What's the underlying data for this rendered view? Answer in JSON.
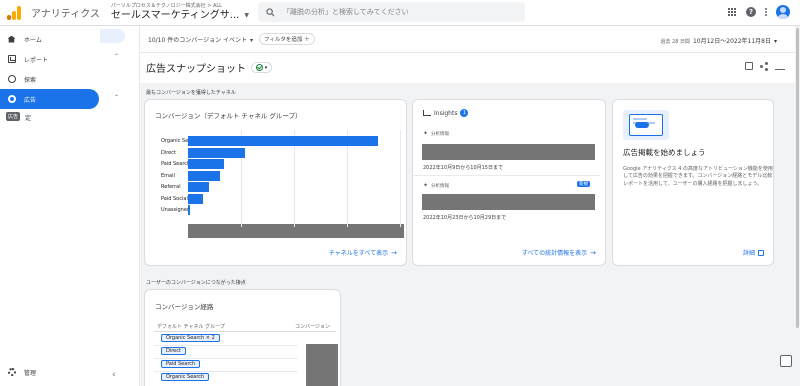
{
  "app": {
    "name": "アナリティクス",
    "account_crumb": "パーソルプロセス＆テクノロジー株式会社 > ALL",
    "property": "セールスマーケティングサ..."
  },
  "search": {
    "placeholder": "「離脱の分析」と検索してみてください"
  },
  "nav": {
    "items": [
      {
        "label": "ホーム",
        "icon": "home-icon"
      },
      {
        "label": "レポート",
        "icon": "reports-icon"
      },
      {
        "label": "探索",
        "icon": "explore-icon"
      },
      {
        "label": "広告",
        "icon": "advertising-icon",
        "active": true
      }
    ],
    "tooltip": "広告",
    "tooltip_rest": "定",
    "admin": "管理"
  },
  "filterbar": {
    "events": "10/10 件のコンバージョン イベント",
    "add_filter": "フィルタを追加 ＋",
    "date_label": "過去 28 日間",
    "date_range": "10月12日～2022年11月8日"
  },
  "page": {
    "title": "広告スナップショット"
  },
  "sections": {
    "top_channel": "最もコンバージョンを獲得したチャネル",
    "journey": "ユーザーのコンバージョンにつながった接点"
  },
  "channel_card": {
    "title": "コンバージョン（デフォルト チャネル グループ）",
    "link": "チャネルをすべて表示",
    "chart_data": {
      "type": "bar",
      "orientation": "horizontal",
      "categories": [
        "Organic Search",
        "Direct",
        "Paid Search",
        "Email",
        "Referral",
        "Paid Social",
        "Unassigned"
      ],
      "values": [
        100,
        30,
        19,
        17,
        11,
        8,
        1
      ],
      "axis_obscured": true
    }
  },
  "insights_card": {
    "title": "Insights",
    "count": "1",
    "items": [
      {
        "label": "分析情報",
        "date": "2022年10月9日から10月15日まで",
        "new": false
      },
      {
        "label": "分析情報",
        "date": "2022年10月23日から10月29日まで",
        "new": true
      }
    ],
    "new_badge": "新規",
    "link": "すべての統計情報を表示"
  },
  "promo_card": {
    "title": "広告掲載を始めましょう",
    "body": "Google アナリティクス 4 の高度なアトリビューション機能を使用して広告の効果を把握できます。コンバージョン経路とモデル比較レポートを活用して、ユーザーの購入経路を把握しましょう。",
    "link": "詳細"
  },
  "path_card": {
    "title": "コンバージョン経路",
    "col_left": "デフォルト チャネル グループ",
    "col_right": "コンバージョン",
    "paths": [
      "Organic Search × 2",
      "Direct",
      "Paid Search",
      "Organic Search"
    ]
  }
}
